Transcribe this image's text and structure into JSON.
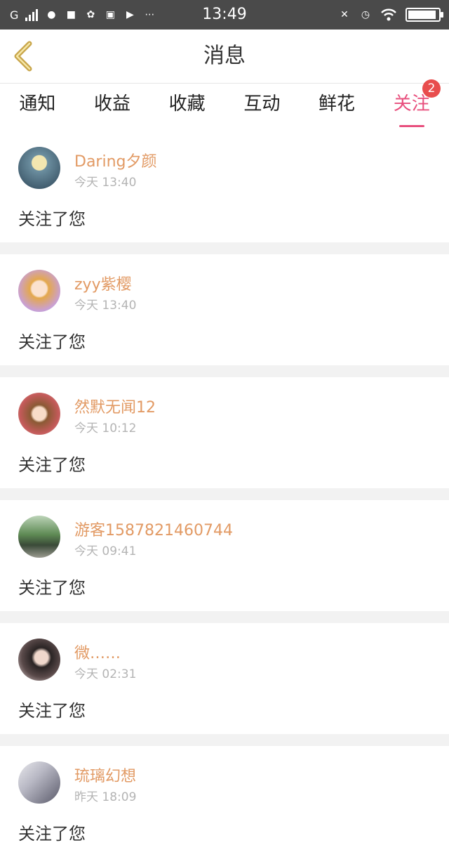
{
  "status_bar": {
    "network": "G",
    "time": "13:49"
  },
  "header": {
    "title": "消息"
  },
  "tabs": [
    {
      "label": "通知"
    },
    {
      "label": "收益"
    },
    {
      "label": "收藏"
    },
    {
      "label": "互动"
    },
    {
      "label": "鲜花"
    },
    {
      "label": "关注",
      "badge": "2"
    }
  ],
  "items": [
    {
      "name": "Daring夕颜",
      "time": "今天 13:40",
      "message": "关注了您"
    },
    {
      "name": "zyy紫樱",
      "time": "今天 13:40",
      "message": "关注了您"
    },
    {
      "name": "然默无闻12",
      "time": "今天 10:12",
      "message": "关注了您"
    },
    {
      "name": "游客1587821460744",
      "time": "今天 09:41",
      "message": "关注了您"
    },
    {
      "name": "微……",
      "time": "今天 02:31",
      "message": "关注了您"
    },
    {
      "name": "琉璃幻想",
      "time": "昨天 18:09",
      "message": "关注了您"
    }
  ],
  "colors": {
    "accent": "#e8507e",
    "name": "#e29a64",
    "badge": "#e84d4d",
    "back_arrow": "#c8a54a"
  }
}
